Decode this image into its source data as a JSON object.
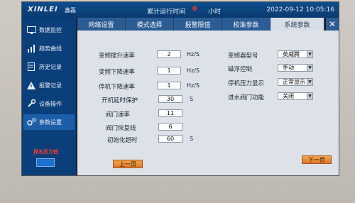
{
  "header": {
    "logo": "XINLEI",
    "logo_sub": "鑫磊",
    "runtime_label": "累计运行时间",
    "runtime_value": "0",
    "runtime_unit": "小时",
    "datetime": "2022-09-12 10:05:16"
  },
  "sidebar": {
    "items": [
      {
        "label": "数据监控",
        "icon": "monitor-icon"
      },
      {
        "label": "趋势曲线",
        "icon": "chart-icon"
      },
      {
        "label": "历史记录",
        "icon": "document-icon"
      },
      {
        "label": "报警记录",
        "icon": "warning-icon"
      },
      {
        "label": "设备操作",
        "icon": "wrench-icon"
      },
      {
        "label": "参数设置",
        "icon": "gears-icon"
      }
    ],
    "alarm_text": "排水压力低"
  },
  "tabs": [
    "网络设置",
    "模式选择",
    "报警限值",
    "校准参数",
    "系统参数"
  ],
  "close_label": "✕",
  "params_left": [
    {
      "label": "变频提升速率",
      "value": "2",
      "unit": "Hz/S"
    },
    {
      "label": "变频下降速率",
      "value": "1",
      "unit": "Hz/S"
    },
    {
      "label": "停机下降速率",
      "value": "1",
      "unit": "Hz/S"
    },
    {
      "label": "开机延时保护",
      "value": "30",
      "unit": "S"
    },
    {
      "label": "阀门速率",
      "value": "11",
      "unit": ""
    },
    {
      "label": "阀门恢复线",
      "value": "6",
      "unit": ""
    },
    {
      "label": "初始化超时",
      "value": "60",
      "unit": "S"
    }
  ],
  "params_right": [
    {
      "label": "变频器型号",
      "value": "英威腾"
    },
    {
      "label": "磁浮控制",
      "value": "手动"
    },
    {
      "label": "停机压力显示",
      "value": "正常显示"
    },
    {
      "label": "进水阀门功能",
      "value": "关闭"
    }
  ],
  "buttons": {
    "prev": "上一页",
    "next": "下一页"
  }
}
